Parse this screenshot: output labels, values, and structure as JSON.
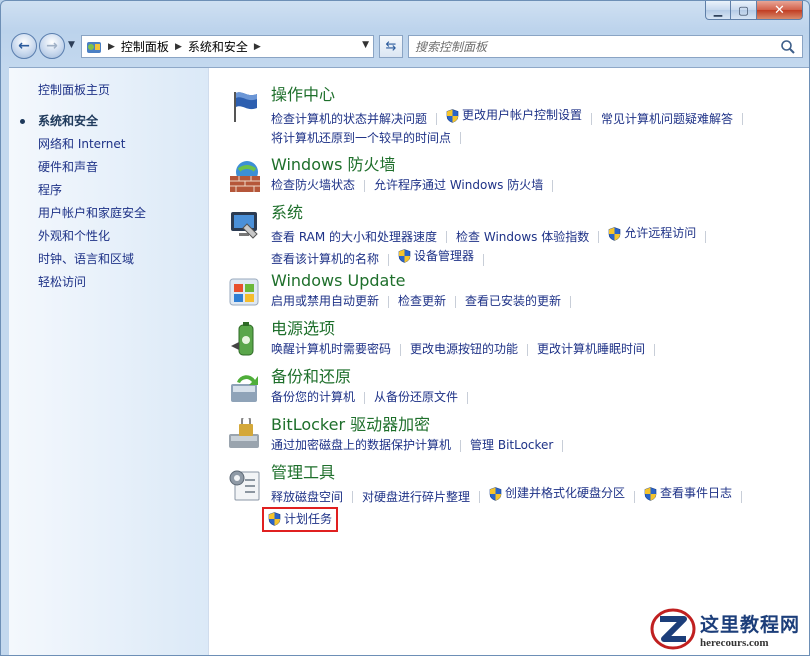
{
  "navigation": {
    "breadcrumb": [
      "控制面板",
      "系统和安全"
    ],
    "search_placeholder": "搜索控制面板"
  },
  "sidebar": {
    "home": "控制面板主页",
    "items": [
      {
        "label": "系统和安全",
        "current": true
      },
      {
        "label": "网络和 Internet"
      },
      {
        "label": "硬件和声音"
      },
      {
        "label": "程序"
      },
      {
        "label": "用户帐户和家庭安全"
      },
      {
        "label": "外观和个性化"
      },
      {
        "label": "时钟、语言和区域"
      },
      {
        "label": "轻松访问"
      }
    ]
  },
  "categories": [
    {
      "title": "操作中心",
      "icon": "flag-icon",
      "lines": [
        [
          {
            "text": "检查计算机的状态并解决问题"
          },
          {
            "text": "更改用户帐户控制设置",
            "shield": true
          },
          {
            "text": "常见计算机问题疑难解答"
          }
        ],
        [
          {
            "text": "将计算机还原到一个较早的时间点"
          }
        ]
      ]
    },
    {
      "title": "Windows 防火墙",
      "icon": "firewall-icon",
      "lines": [
        [
          {
            "text": "检查防火墙状态"
          },
          {
            "text": "允许程序通过 Windows 防火墙"
          }
        ]
      ]
    },
    {
      "title": "系统",
      "icon": "system-icon",
      "lines": [
        [
          {
            "text": "查看 RAM 的大小和处理器速度"
          },
          {
            "text": "检查 Windows 体验指数"
          },
          {
            "text": "允许远程访问",
            "shield": true
          }
        ],
        [
          {
            "text": "查看该计算机的名称"
          },
          {
            "text": "设备管理器",
            "shield": true
          }
        ]
      ]
    },
    {
      "title": "Windows Update",
      "icon": "windows-update-icon",
      "lines": [
        [
          {
            "text": "启用或禁用自动更新"
          },
          {
            "text": "检查更新"
          },
          {
            "text": "查看已安装的更新"
          }
        ]
      ]
    },
    {
      "title": "电源选项",
      "icon": "power-icon",
      "lines": [
        [
          {
            "text": "唤醒计算机时需要密码"
          },
          {
            "text": "更改电源按钮的功能"
          },
          {
            "text": "更改计算机睡眠时间"
          }
        ]
      ]
    },
    {
      "title": "备份和还原",
      "icon": "backup-icon",
      "lines": [
        [
          {
            "text": "备份您的计算机"
          },
          {
            "text": "从备份还原文件"
          }
        ]
      ]
    },
    {
      "title": "BitLocker 驱动器加密",
      "icon": "bitlocker-icon",
      "lines": [
        [
          {
            "text": "通过加密磁盘上的数据保护计算机"
          },
          {
            "text": "管理 BitLocker"
          }
        ]
      ]
    },
    {
      "title": "管理工具",
      "icon": "admin-tools-icon",
      "lines": [
        [
          {
            "text": "释放磁盘空间"
          },
          {
            "text": "对硬盘进行碎片整理"
          },
          {
            "text": "创建并格式化硬盘分区",
            "shield": true
          },
          {
            "text": "查看事件日志",
            "shield": true
          }
        ],
        [
          {
            "text": "计划任务",
            "shield": true,
            "highlight": true
          }
        ]
      ]
    }
  ],
  "watermark": {
    "title": "这里教程网",
    "url": "herecours.com"
  },
  "colors": {
    "link": "#1e3287",
    "category_title": "#1e6f2b",
    "highlight_border": "#e02020"
  }
}
